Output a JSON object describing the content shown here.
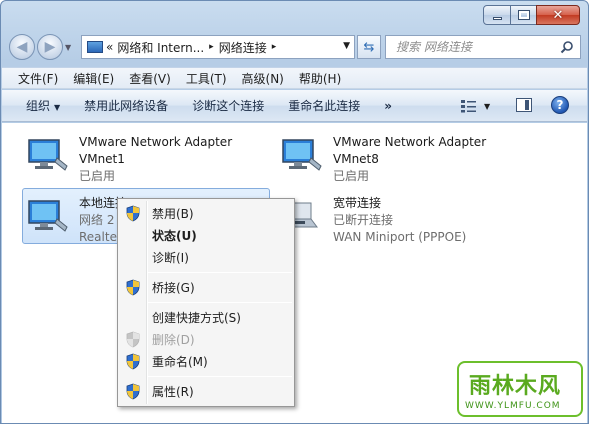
{
  "window": {
    "address": {
      "back_chevron": "«",
      "crumb_1": "网络和 Intern...",
      "separator": "▸",
      "crumb_2": "网络连接",
      "separator_2": "▸"
    },
    "search": {
      "placeholder": "搜索 网络连接"
    },
    "caption": {
      "close": "✕"
    }
  },
  "menubar": {
    "items": [
      "文件(F)",
      "编辑(E)",
      "查看(V)",
      "工具(T)",
      "高级(N)",
      "帮助(H)"
    ]
  },
  "cmdbar": {
    "organize": "组织",
    "disable": "禁用此网络设备",
    "diagnose": "诊断这个连接",
    "rename": "重命名此连接",
    "more": "»",
    "help": "?"
  },
  "connections": [
    {
      "name": "VMware Network Adapter",
      "status": "VMnet1",
      "device": "已启用"
    },
    {
      "name": "VMware Network Adapter",
      "status": "VMnet8",
      "device": "已启用"
    },
    {
      "name": "本地连接",
      "status": "网络  2",
      "device": "Realte"
    },
    {
      "name": "宽带连接",
      "status": "已断开连接",
      "device": "WAN Miniport (PPPOE)"
    }
  ],
  "context_menu": {
    "disable": "禁用(B)",
    "status": "状态(U)",
    "diagnose": "诊断(I)",
    "bridge": "桥接(G)",
    "shortcut": "创建快捷方式(S)",
    "delete": "删除(D)",
    "rename": "重命名(M)",
    "properties": "属性(R)"
  },
  "watermark": {
    "title": "雨林木风",
    "url": "WWW.YLMFU.COM"
  },
  "colors": {
    "accent": "#2b67b8",
    "selection": "#cfe3fa",
    "watermark": "#6cbf2c"
  }
}
